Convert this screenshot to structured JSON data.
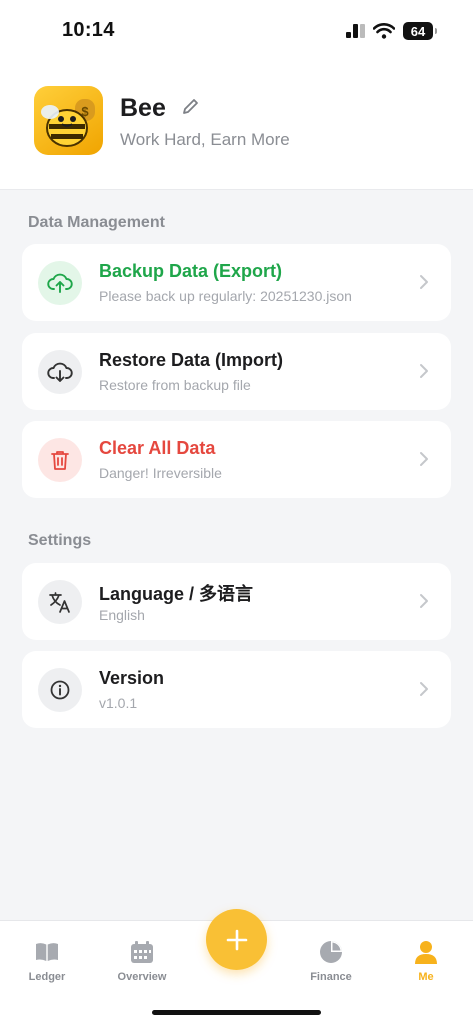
{
  "status_bar": {
    "time": "10:14",
    "battery": "64"
  },
  "profile": {
    "name": "Bee",
    "motto": "Work Hard, Earn More"
  },
  "data_management": {
    "title": "Data Management",
    "items": [
      {
        "title": "Backup Data (Export)",
        "subtitle": "Please back up regularly: 20251230.json",
        "title_color": "#1fa64a",
        "icon": "cloud-upload-icon"
      },
      {
        "title": "Restore Data (Import)",
        "subtitle": "Restore from backup file",
        "title_color": "#1d1d1f",
        "icon": "cloud-download-icon"
      },
      {
        "title": "Clear All Data",
        "subtitle": "Danger! Irreversible",
        "title_color": "#e5483f",
        "icon": "trash-icon"
      }
    ]
  },
  "settings": {
    "title": "Settings",
    "items": [
      {
        "title": "Language / 多语言",
        "subtitle": "English",
        "icon": "translate-icon"
      },
      {
        "title": "Version",
        "subtitle": "v1.0.1",
        "icon": "info-icon"
      }
    ]
  },
  "tabbar": {
    "tabs": [
      {
        "label": "Ledger",
        "icon": "book-icon"
      },
      {
        "label": "Overview",
        "icon": "calendar-icon"
      },
      {
        "label": "Finance",
        "icon": "pie-chart-icon"
      },
      {
        "label": "Me",
        "icon": "person-icon",
        "active": true
      }
    ],
    "add_icon": "plus-icon"
  },
  "colors": {
    "accent": "#f9c035",
    "success": "#1fa64a",
    "danger": "#e5483f"
  }
}
